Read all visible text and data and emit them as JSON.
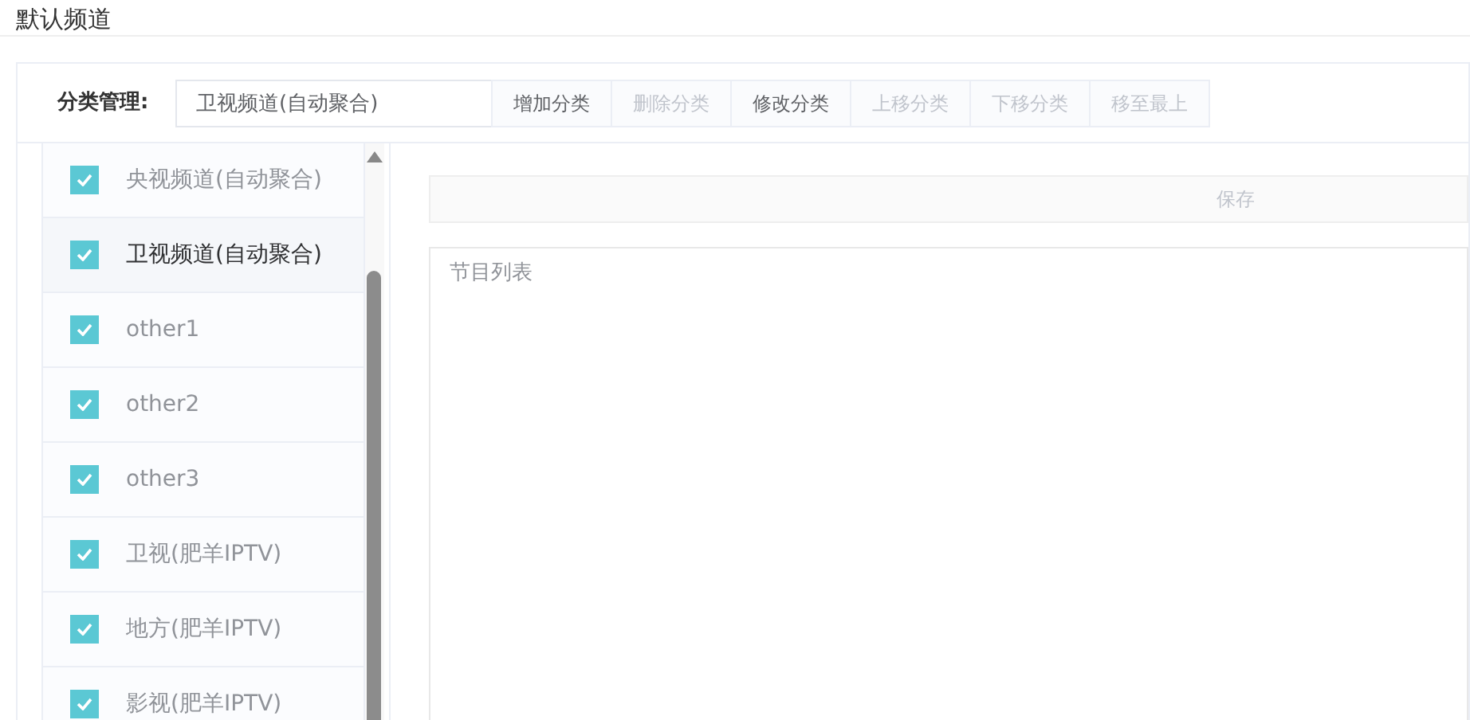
{
  "page_title": "默认频道",
  "category_manager": {
    "label": "分类管理:",
    "value": "卫视频道(自动聚合)",
    "buttons": [
      {
        "label": "增加分类",
        "disabled": false
      },
      {
        "label": "删除分类",
        "disabled": true
      },
      {
        "label": "修改分类",
        "disabled": false
      },
      {
        "label": "上移分类",
        "disabled": true
      },
      {
        "label": "下移分类",
        "disabled": true
      },
      {
        "label": "移至最上",
        "disabled": true
      }
    ]
  },
  "categories": [
    {
      "name": "央视频道(自动聚合)",
      "checked": true,
      "selected": false
    },
    {
      "name": "卫视频道(自动聚合)",
      "checked": true,
      "selected": true
    },
    {
      "name": "other1",
      "checked": true,
      "selected": false
    },
    {
      "name": "other2",
      "checked": true,
      "selected": false
    },
    {
      "name": "other3",
      "checked": true,
      "selected": false
    },
    {
      "name": "卫视(肥羊IPTV)",
      "checked": true,
      "selected": false
    },
    {
      "name": "地方(肥羊IPTV)",
      "checked": true,
      "selected": false
    },
    {
      "name": "影视(肥羊IPTV)",
      "checked": true,
      "selected": false
    }
  ],
  "save_button": "保存",
  "program_list": {
    "placeholder": "节目列表"
  }
}
